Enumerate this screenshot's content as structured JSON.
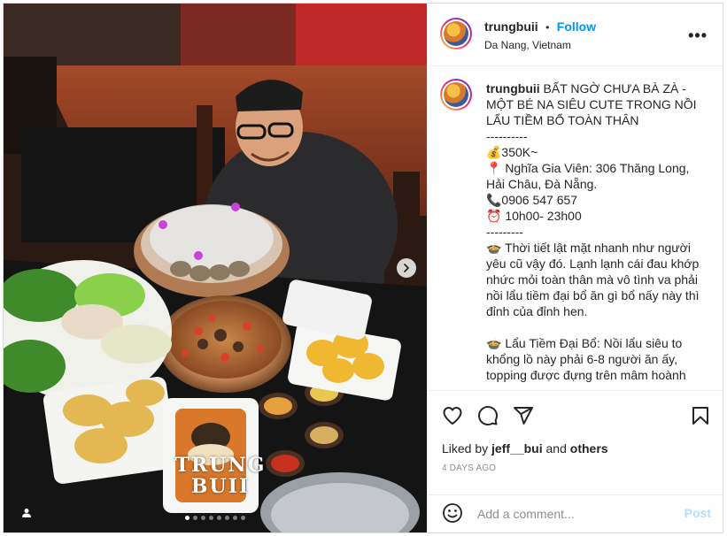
{
  "post": {
    "username": "trungbuii",
    "follow_label": "Follow",
    "separator": "•",
    "location": "Da Nang, Vietnam",
    "more_label": "•••"
  },
  "media": {
    "watermark_line1": "TRUNG",
    "watermark_line2": "BUII",
    "carousel_count": 8,
    "carousel_active": 1
  },
  "caption": {
    "username": "trungbuii",
    "text": "BẤT NGỜ CHƯA BÀ ZÀ - MỘT BÉ NA SIÊU CUTE TRONG NỒI LẨU TIỀM BỔ TOÀN THÂN\n----------\n💰350K~\n📍 Nghĩa Gia Viên: 306 Thăng Long, Hải Châu, Đà Nẵng.\n📞0906 547 657\n⏰ 10h00- 23h00\n---------\n🍲 Thời tiết lật mặt nhanh như người yêu cũ vậy đó. Lạnh lạnh cái đau khớp nhức mỏi toàn thân mà vô tình va phải nồi lẩu tiềm đại bổ ăn gì bổ nấy này thì đỉnh của đỉnh hen.\n\n🍲 Lẩu Tiềm Đại Bổ: Nồi lẩu siêu to khổng lồ này phải 6-8 người ăn ấy, topping được đựng trên mâm hoành"
  },
  "actions": {
    "liked_prefix": "Liked by",
    "liked_user": "jeff__bui",
    "liked_and": "and",
    "liked_others": "others",
    "date": "4 DAYS AGO"
  },
  "comment": {
    "placeholder": "Add a comment...",
    "post_label": "Post",
    "post_color": "#b2dffc"
  },
  "colors": {
    "follow": "#0095f6",
    "border": "#dbdbdb",
    "muted": "#8e8e8e"
  },
  "icons": [
    "heart-icon",
    "comment-icon",
    "share-icon",
    "bookmark-icon",
    "emoji-icon",
    "more-icon",
    "chevron-right-icon",
    "user-tag-icon"
  ]
}
